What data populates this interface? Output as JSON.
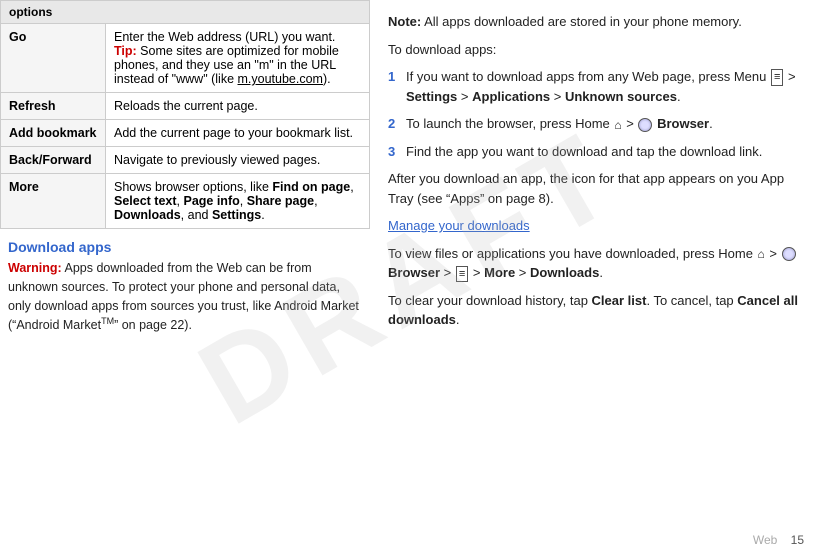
{
  "table": {
    "header": "options",
    "rows": [
      {
        "option": "Go",
        "description": "Enter the Web address (URL) you want.",
        "tip": "Tip: Some sites are optimized for mobile phones, and they use an \"m\" in the URL instead of \"www\" (like m.youtube.com)."
      },
      {
        "option": "Refresh",
        "description": "Reloads the current page.",
        "tip": null
      },
      {
        "option": "Add bookmark",
        "description": "Add the current page to your bookmark list.",
        "tip": null
      },
      {
        "option": "Back/Forward",
        "description": "Navigate to previously viewed pages.",
        "tip": null
      },
      {
        "option": "More",
        "description": "Shows browser options, like Find on page, Select text, Page info, Share page, Downloads, and Settings.",
        "tip": null
      }
    ]
  },
  "download_apps": {
    "title": "Download apps",
    "warning_label": "Warning:",
    "warning_text": " Apps downloaded from the Web can be from unknown sources. To protect your phone and personal data, only download apps from sources you trust, like Android Market (“Android Market",
    "warning_tm": "TM",
    "warning_end": "” on page 22)."
  },
  "right_panel": {
    "note_label": "Note:",
    "note_text": " All apps downloaded are stored in your phone memory.",
    "to_download": "To download apps:",
    "steps": [
      {
        "num": "1",
        "text_before": "If you want to download apps from any Web page, press Menu ",
        "menu_icon": "≡",
        "text_mid1": " > ",
        "bold1": "Settings",
        "text_mid2": " > ",
        "bold2": "Applications",
        "text_mid3": " > ",
        "bold3": "Unknown sources",
        "text_end": "."
      },
      {
        "num": "2",
        "text_before": "To launch the browser, press Home ",
        "home_icon": "⌂",
        "text_mid1": " > ",
        "globe_icon": true,
        "bold1": " Browser",
        "text_end": "."
      },
      {
        "num": "3",
        "text": "Find the app you want to download and tap the download link."
      }
    ],
    "after_download": "After you download an app, the icon for that app appears on you App Tray (see “Apps” on page 8).",
    "manage_title": "Manage your downloads",
    "manage_text1_before": "To view files or applications you have downloaded, press Home ",
    "manage_home": "⌂",
    "manage_mid1": " > ",
    "manage_globe": true,
    "manage_bold1": " Browser",
    "manage_mid2": " > ",
    "manage_menu": "≡",
    "manage_mid3": " > ",
    "manage_bold2": "More",
    "manage_mid4": " > ",
    "manage_bold3": "Downloads",
    "manage_end": ".",
    "clear_text_before": "To clear your download history, tap ",
    "clear_bold": "Clear list",
    "clear_mid": ". To cancel, tap ",
    "cancel_bold": "Cancel all downloads",
    "clear_end": ".",
    "page_label": "Web",
    "page_num": "15"
  }
}
